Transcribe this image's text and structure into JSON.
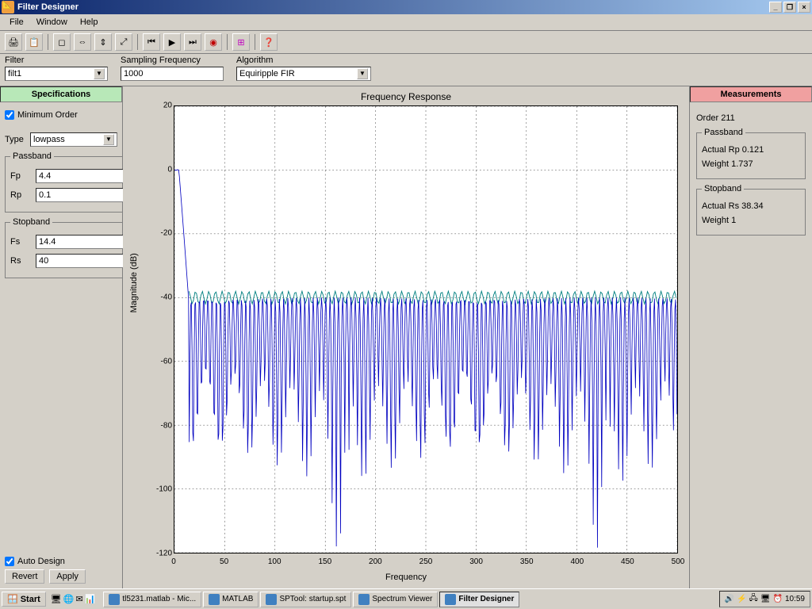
{
  "window": {
    "title": "Filter Designer"
  },
  "menu": {
    "file": "File",
    "window": "Window",
    "help": "Help"
  },
  "params": {
    "filter_label": "Filter",
    "filter_value": "filt1",
    "fs_label": "Sampling Frequency",
    "fs_value": "1000",
    "algo_label": "Algorithm",
    "algo_value": "Equiripple FIR"
  },
  "spec": {
    "header": "Specifications",
    "min_order": "Minimum Order",
    "type_label": "Type",
    "type_value": "lowpass",
    "passband_legend": "Passband",
    "fp_label": "Fp",
    "fp_value": "4.4",
    "rp_label": "Rp",
    "rp_value": "0.1",
    "stopband_legend": "Stopband",
    "fstop_label": "Fs",
    "fstop_value": "14.4",
    "rs_label": "Rs",
    "rs_value": "40",
    "auto_design": "Auto Design",
    "revert": "Revert",
    "apply": "Apply"
  },
  "meas": {
    "header": "Measurements",
    "order_label": "Order",
    "order_value": "211",
    "passband_legend": "Passband",
    "actual_rp": "Actual Rp  0.121",
    "weight_p": "Weight  1.737",
    "stopband_legend": "Stopband",
    "actual_rs": "Actual Rs  38.34",
    "weight_s": "Weight  1"
  },
  "chart_data": {
    "type": "line",
    "title": "Frequency Response",
    "xlabel": "Frequency",
    "ylabel": "Magnitude (dB)",
    "xlim": [
      0,
      500
    ],
    "ylim": [
      -120,
      20
    ],
    "xticks": [
      0,
      50,
      100,
      150,
      200,
      250,
      300,
      350,
      400,
      450,
      500
    ],
    "yticks": [
      20,
      0,
      -20,
      -40,
      -60,
      -80,
      -100,
      -120
    ],
    "passband_edge": 4.4,
    "stopband_edge": 14.4,
    "stopband_level_db": -40,
    "ripple_depth_db_range": [
      -45,
      -105
    ],
    "note": "Lowpass equiripple FIR magnitude response: ~0 dB in passband (0–4.4 Hz), transition 4.4–14.4 Hz, equiripple lobes below −40 dB across 14.4–500 Hz."
  },
  "taskbar": {
    "start": "Start",
    "items": [
      "tl5231.matlab - Mic...",
      "MATLAB",
      "SPTool: startup.spt",
      "Spectrum Viewer",
      "Filter Designer"
    ],
    "clock": "10:59"
  }
}
